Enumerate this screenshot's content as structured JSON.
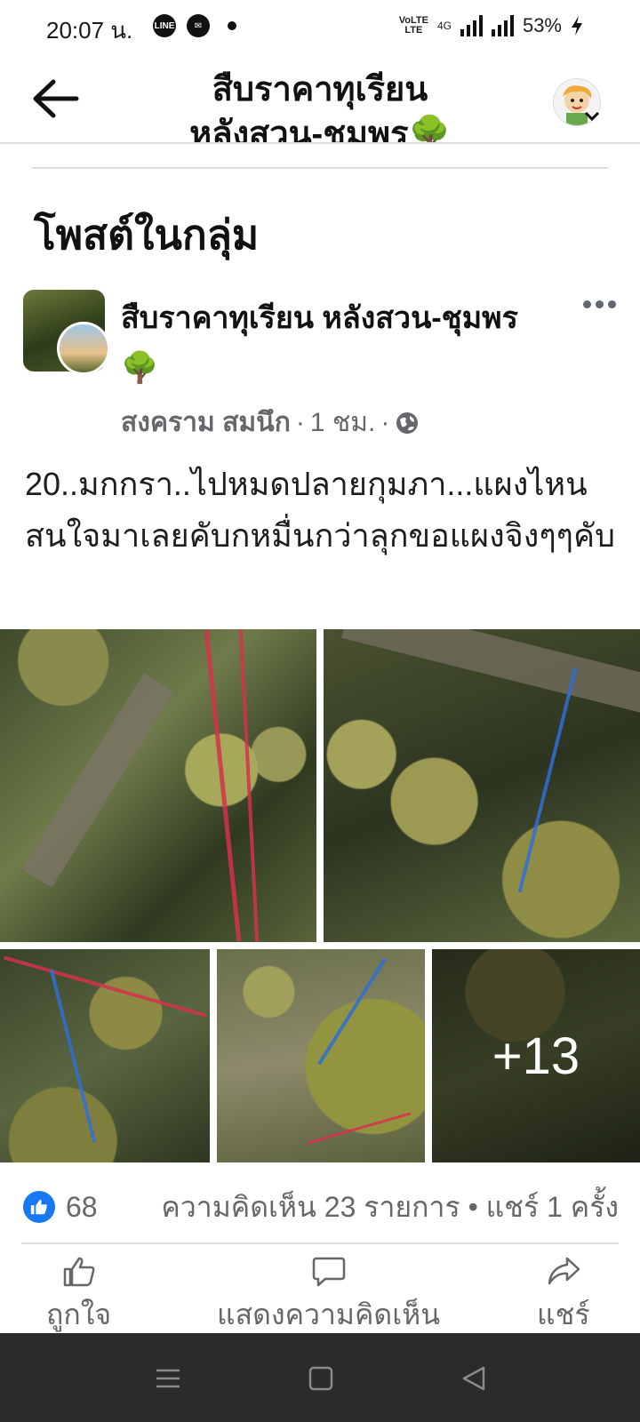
{
  "status_bar": {
    "time": "20:07 น.",
    "network": "4G",
    "battery": "53%"
  },
  "header": {
    "title": "สืบราคาทุเรียน หลังสวน-ชุมพร🌳"
  },
  "section_title": "โพสต์ในกลุ่ม",
  "post": {
    "group_name": "สืบราคาทุเรียน หลังสวน-ชุมพร🌳",
    "author": "สงคราม สมนึก",
    "time": "1 ชม.",
    "text": "20..มกกรา..ไปหมดปลายกุมภา...แผงไหนสนใจมาเลยคับกหมื่นกว่าลุกขอแผงจิงๆๆคับ",
    "more_photos": "+13",
    "like_count": "68",
    "engagement": "ความคิดเห็น 23 รายการ • แชร์ 1 ครั้ง"
  },
  "actions": {
    "like": "ถูกใจ",
    "comment": "แสดงความคิดเห็น",
    "share": "แชร์"
  },
  "colors": {
    "accent": "#1877f2",
    "nav_background": "#2b2b2b"
  }
}
